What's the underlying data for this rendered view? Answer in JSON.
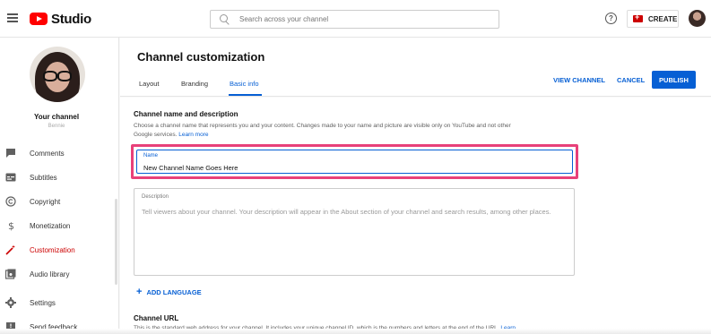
{
  "app": {
    "logo_text": "Studio"
  },
  "search": {
    "placeholder": "Search across your channel"
  },
  "topbar": {
    "create_label": "CREATE",
    "help_symbol": "?"
  },
  "sidebar": {
    "channel_title": "Your channel",
    "channel_subtitle": "Bennie",
    "items": [
      {
        "label": "Comments",
        "icon": "comment-icon"
      },
      {
        "label": "Subtitles",
        "icon": "subtitles-icon"
      },
      {
        "label": "Copyright",
        "icon": "copyright-icon"
      },
      {
        "label": "Monetization",
        "icon": "dollar-icon"
      },
      {
        "label": "Customization",
        "icon": "magic-wand-icon",
        "active": true
      },
      {
        "label": "Audio library",
        "icon": "audio-library-icon"
      },
      {
        "label": "Settings",
        "icon": "gear-icon"
      },
      {
        "label": "Send feedback",
        "icon": "feedback-icon"
      }
    ]
  },
  "header": {
    "title": "Channel customization",
    "tabs": [
      {
        "label": "Layout"
      },
      {
        "label": "Branding"
      },
      {
        "label": "Basic info",
        "active": true
      }
    ],
    "view_channel": "VIEW CHANNEL",
    "cancel": "CANCEL",
    "publish": "PUBLISH"
  },
  "basic_info": {
    "section_title": "Channel name and description",
    "section_desc_line1": "Choose a channel name that represents you and your content. Changes made to your name and picture are visible only on YouTube and not other",
    "section_desc_line2": "Google services.",
    "learn_more": "Learn more",
    "name_label": "Name",
    "name_value": "New Channel Name Goes Here",
    "description_label": "Description",
    "description_placeholder": "Tell viewers about your channel. Your description will appear in the About section of your channel and search results, among other places.",
    "add_language": "ADD LANGUAGE",
    "url_title": "Channel URL",
    "url_desc": "This is the standard web address for your channel. It includes your unique channel ID, which is the numbers and letters at the end of the URL.",
    "url_learn": "Learn"
  },
  "colors": {
    "accent": "#065fd4",
    "highlight": "#e8417a",
    "brand": "#ff0000"
  }
}
